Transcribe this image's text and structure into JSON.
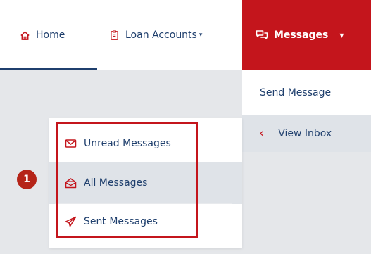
{
  "navbar": {
    "home_label": "Home",
    "loan_accounts_label": "Loan Accounts",
    "messages_label": "Messages",
    "caret": "▾"
  },
  "submenu": {
    "send_message_label": "Send Message",
    "view_inbox_label": "View Inbox",
    "view_inbox_chevron": "‹"
  },
  "inbox_dropdown": {
    "items": [
      {
        "label": "Unread Messages",
        "icon": "envelope-icon"
      },
      {
        "label": "All Messages",
        "icon": "envelope-open-icon"
      },
      {
        "label": "Sent Messages",
        "icon": "paper-plane-icon"
      }
    ]
  },
  "annotation": {
    "step_number": "1",
    "highlight_color": "#c4151c"
  },
  "colors": {
    "brand_red": "#c4151c",
    "navy_text": "#1f3f6d",
    "hover_gray": "#dfe3e8",
    "background_gray": "#e5e7ea"
  }
}
